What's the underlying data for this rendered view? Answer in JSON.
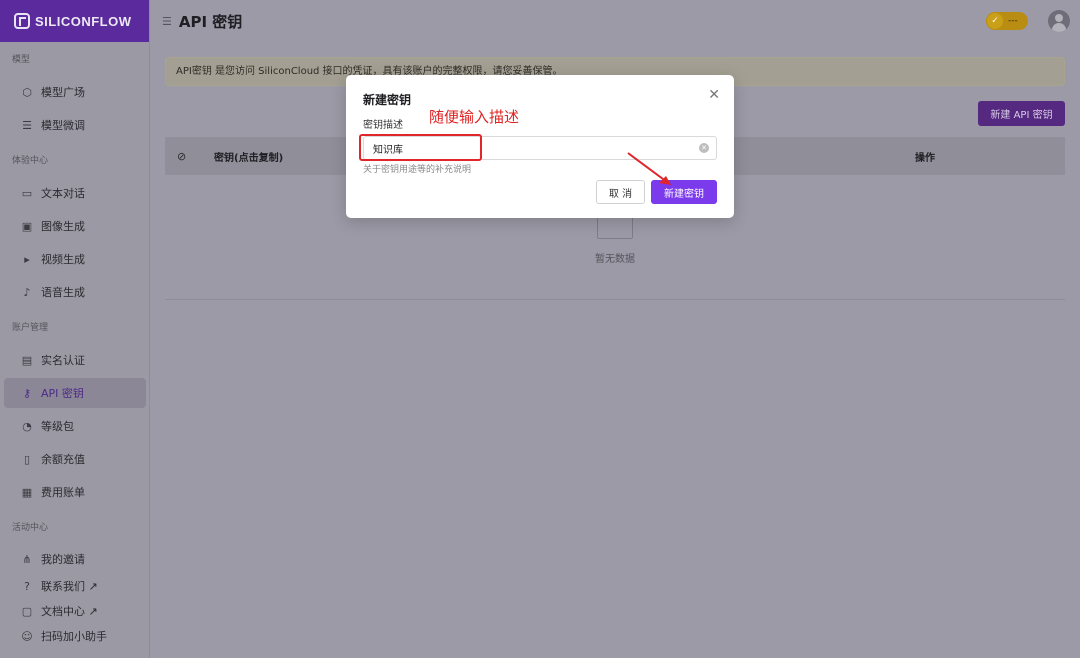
{
  "app": {
    "logo_text": "SILICONFLOW"
  },
  "header": {
    "title": "API 密钥",
    "vip_text": "---"
  },
  "sidebar": {
    "sections": [
      {
        "label": "模型",
        "items": [
          {
            "label": "模型广场",
            "icon": "cube-icon"
          },
          {
            "label": "模型微调",
            "icon": "sliders-icon"
          }
        ]
      },
      {
        "label": "体验中心",
        "items": [
          {
            "label": "文本对话",
            "icon": "chat-icon"
          },
          {
            "label": "图像生成",
            "icon": "image-icon"
          },
          {
            "label": "视频生成",
            "icon": "video-icon"
          },
          {
            "label": "语音生成",
            "icon": "mic-icon"
          }
        ]
      },
      {
        "label": "账户管理",
        "items": [
          {
            "label": "实名认证",
            "icon": "id-card-icon"
          },
          {
            "label": "API 密钥",
            "icon": "key-icon",
            "active": true
          },
          {
            "label": "等级包",
            "icon": "gauge-icon"
          },
          {
            "label": "余额充值",
            "icon": "wallet-icon"
          },
          {
            "label": "费用账单",
            "icon": "bill-icon"
          }
        ]
      },
      {
        "label": "活动中心",
        "items": [
          {
            "label": "我的邀请",
            "icon": "share-icon"
          },
          {
            "label": "联系我们 ↗",
            "icon": "help-icon"
          },
          {
            "label": "文档中心 ↗",
            "icon": "doc-icon"
          },
          {
            "label": "扫码加小助手",
            "icon": "user-icon"
          }
        ]
      }
    ]
  },
  "main": {
    "notice": "API密钥 是您访问 SiliconCloud 接口的凭证，具有该账户的完整权限，请您妥善保管。",
    "new_key_button": "新建 API 密钥",
    "table": {
      "col_key": "密钥(点击复制)",
      "col_actions": "操作"
    },
    "empty_text": "暂无数据"
  },
  "modal": {
    "title": "新建密钥",
    "field_label": "密钥描述",
    "input_value": "知识库",
    "help_text": "关于密钥用途等的补充说明",
    "cancel_label": "取 消",
    "create_label": "新建密钥"
  },
  "annotation": {
    "text": "随便输入描述",
    "color": "#e02424"
  },
  "colors": {
    "accent": "#7c3aed",
    "brand_bar": "#5b2a9c",
    "annotation": "#e0262a"
  }
}
